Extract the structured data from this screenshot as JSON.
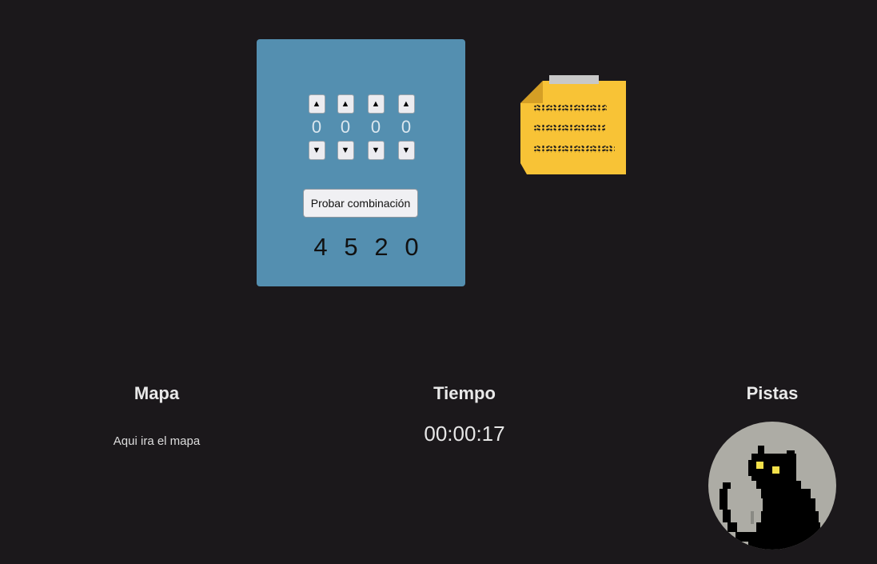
{
  "lock": {
    "dials": [
      {
        "up_icon": "▲",
        "value": "0",
        "down_icon": "▼"
      },
      {
        "up_icon": "▲",
        "value": "0",
        "down_icon": "▼"
      },
      {
        "up_icon": "▲",
        "value": "0",
        "down_icon": "▼"
      },
      {
        "up_icon": "▲",
        "value": "0",
        "down_icon": "▼"
      }
    ],
    "try_button_label": "Probar combinación",
    "combination": [
      "4",
      "5",
      "2",
      "0"
    ]
  },
  "sections": {
    "map": {
      "title": "Mapa",
      "text": "Aqui ira el mapa"
    },
    "time": {
      "title": "Tiempo",
      "value": "00:00:17"
    },
    "hints": {
      "title": "Pistas",
      "icon": "black-cat-icon"
    }
  },
  "colors": {
    "background": "#1b181b",
    "lock_panel": "#548fb0",
    "sticky_note": "#f8c336",
    "hint_circle": "#adaca5",
    "cat_eyes": "#f2e04a"
  }
}
